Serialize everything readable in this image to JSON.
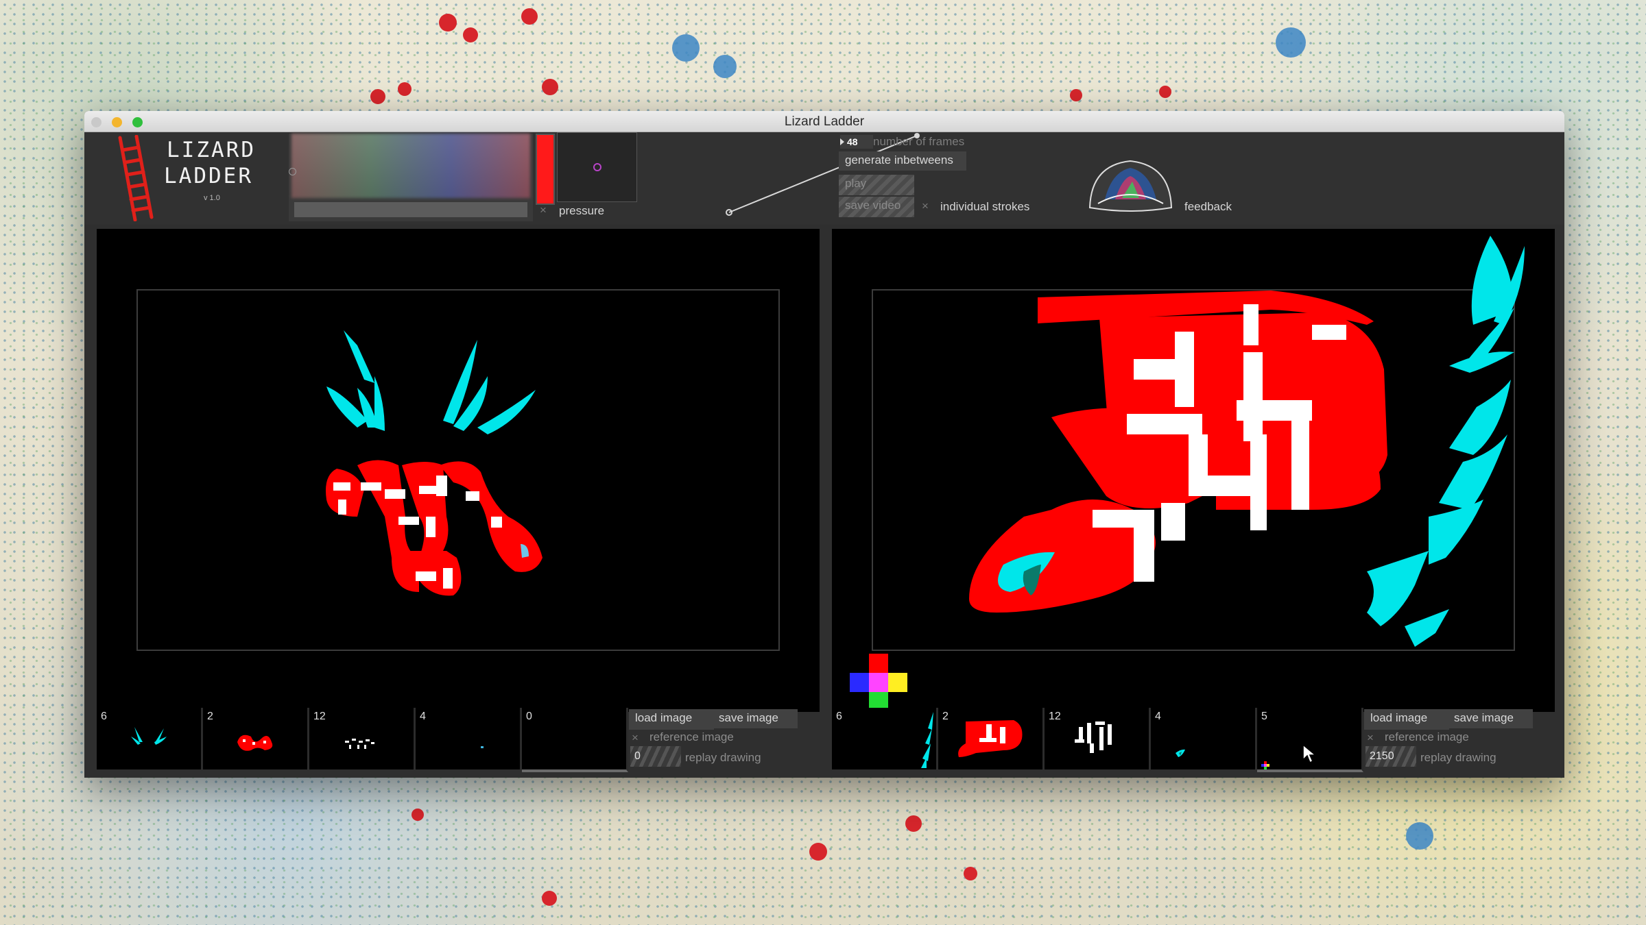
{
  "window": {
    "title": "Lizard Ladder"
  },
  "logo": {
    "line1": "LIZARD",
    "line2": "LADDER",
    "version": "v 1.0"
  },
  "toolbar": {
    "current_color": "#ff1a1a",
    "pressure_label": "pressure",
    "frames_value": "48",
    "frames_label": "number of frames",
    "generate_label": "generate inbetweens",
    "play_label": "play",
    "save_video_label": "save video",
    "strokes_label": "individual strokes",
    "feedback_label": "feedback",
    "toggle_glyph": "×"
  },
  "left_strip": {
    "thumbs": [
      {
        "count": "6"
      },
      {
        "count": "2"
      },
      {
        "count": "12"
      },
      {
        "count": "4"
      },
      {
        "count": "0"
      }
    ],
    "load_label": "load image",
    "save_label": "save image",
    "reference_label": "reference image",
    "replay_value": "0",
    "replay_label": "replay drawing"
  },
  "right_strip": {
    "thumbs": [
      {
        "count": "6"
      },
      {
        "count": "2"
      },
      {
        "count": "12"
      },
      {
        "count": "4"
      },
      {
        "count": "5"
      }
    ],
    "load_label": "load image",
    "save_label": "save image",
    "reference_label": "reference image",
    "replay_value": "2150",
    "replay_label": "replay drawing"
  },
  "colors": {
    "red": "#ff0000",
    "cyan": "#00e6ea",
    "white": "#ffffff",
    "window_bg": "#2f2f2f"
  }
}
